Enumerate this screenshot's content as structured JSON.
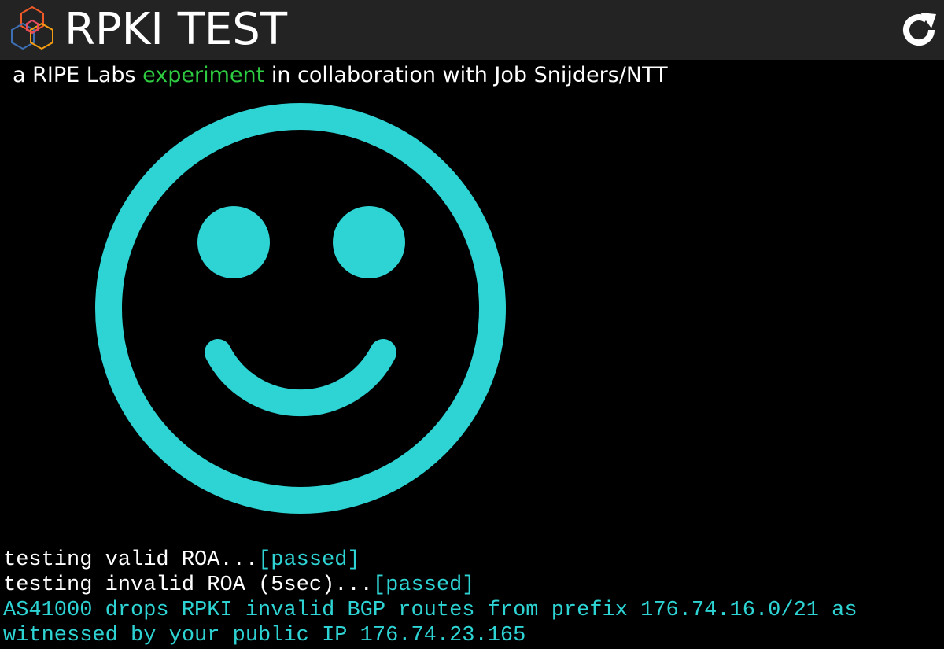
{
  "header": {
    "title": "RPKI TEST",
    "logo_icon": "ripe-hexagon-logo-icon",
    "reload_icon": "reload-icon"
  },
  "subtitle": {
    "before": "a RIPE Labs ",
    "link": "experiment",
    "after": " in collaboration with Job Snijders/NTT"
  },
  "result": {
    "icon": "smiley-face-icon",
    "color": "#2ed3d3"
  },
  "log": {
    "line1": {
      "text": "testing valid ROA...",
      "status": "[passed]"
    },
    "line2": {
      "text": "testing invalid ROA (5sec)...",
      "status": "[passed]"
    },
    "result_line1": "AS41000 drops RPKI invalid BGP routes from prefix 176.74.16.0/21 as",
    "result_line2": "witnessed by your public IP 176.74.23.165"
  },
  "colors": {
    "background": "#000000",
    "header_bg": "#232323",
    "accent_green": "#2ecc40",
    "teal": "#2ed3d3"
  }
}
